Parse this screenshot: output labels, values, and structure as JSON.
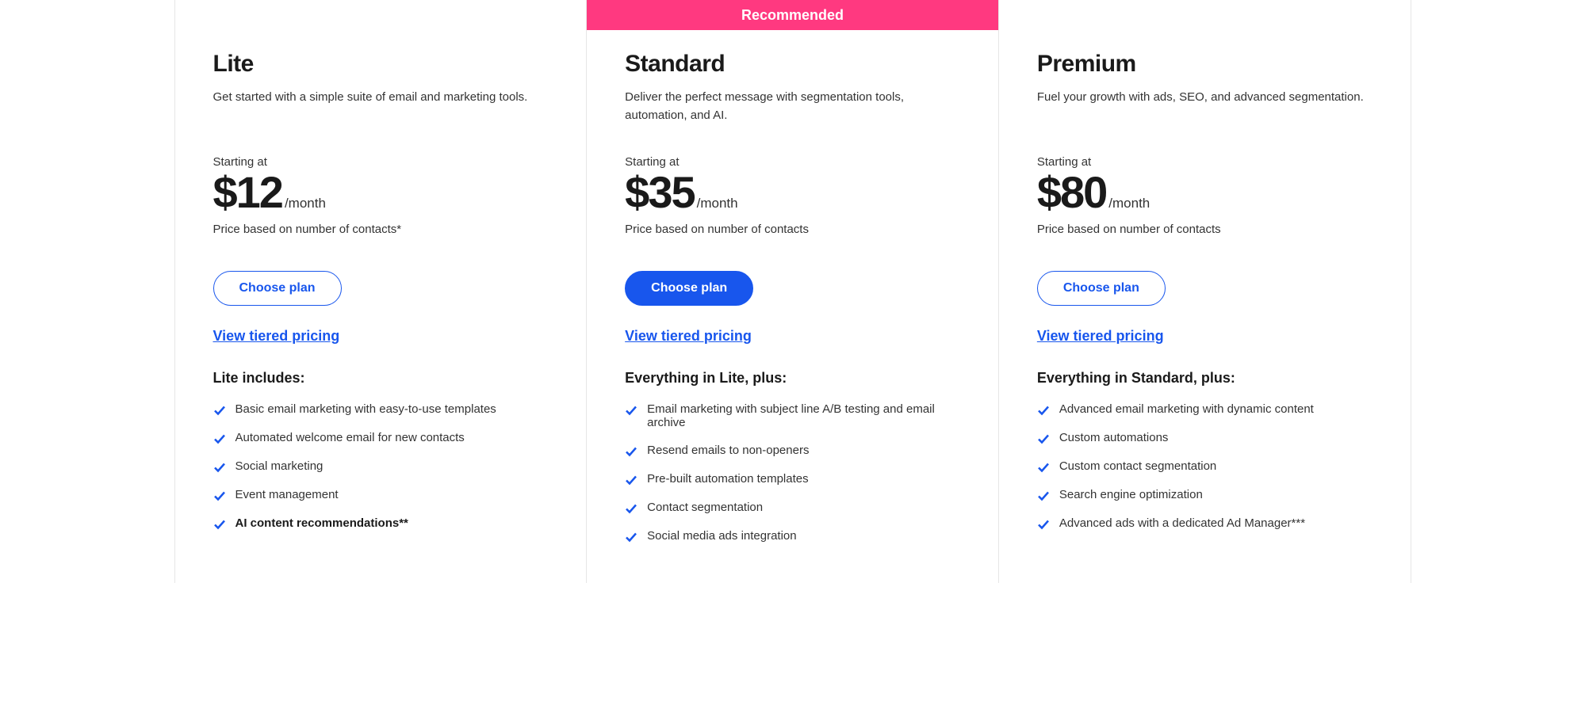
{
  "recommended_label": "Recommended",
  "common": {
    "starting_at": "Starting at",
    "price_suffix": "/month",
    "choose_plan": "Choose plan",
    "view_tiered": "View tiered pricing"
  },
  "plans": [
    {
      "id": "lite",
      "title": "Lite",
      "description": "Get started with a simple suite of email and marketing tools.",
      "price": "$12",
      "price_note": "Price based on number of contacts*",
      "recommended": false,
      "includes_heading": "Lite includes:",
      "features": [
        {
          "text": "Basic email marketing with easy-to-use templates",
          "bold": false
        },
        {
          "text": "Automated welcome email for new contacts",
          "bold": false
        },
        {
          "text": "Social marketing",
          "bold": false
        },
        {
          "text": "Event management",
          "bold": false
        },
        {
          "text": "AI content recommendations**",
          "bold": true
        }
      ]
    },
    {
      "id": "standard",
      "title": "Standard",
      "description": "Deliver the perfect message with segmentation tools, automation, and AI.",
      "price": "$35",
      "price_note": "Price based on number of contacts",
      "recommended": true,
      "includes_heading": "Everything in Lite, plus:",
      "features": [
        {
          "text": "Email marketing with subject line A/B testing and email archive",
          "bold": false
        },
        {
          "text": "Resend emails to non-openers",
          "bold": false
        },
        {
          "text": "Pre-built automation templates",
          "bold": false
        },
        {
          "text": "Contact segmentation",
          "bold": false
        },
        {
          "text": "Social media ads integration",
          "bold": false
        }
      ]
    },
    {
      "id": "premium",
      "title": "Premium",
      "description": "Fuel your growth with ads, SEO, and advanced segmentation.",
      "price": "$80",
      "price_note": "Price based on number of contacts",
      "recommended": false,
      "includes_heading": "Everything in Standard, plus:",
      "features": [
        {
          "text": "Advanced email marketing with dynamic content",
          "bold": false
        },
        {
          "text": "Custom automations",
          "bold": false
        },
        {
          "text": "Custom contact segmentation",
          "bold": false
        },
        {
          "text": "Search engine optimization",
          "bold": false
        },
        {
          "text": "Advanced ads with a dedicated Ad Manager***",
          "bold": false
        }
      ]
    }
  ]
}
